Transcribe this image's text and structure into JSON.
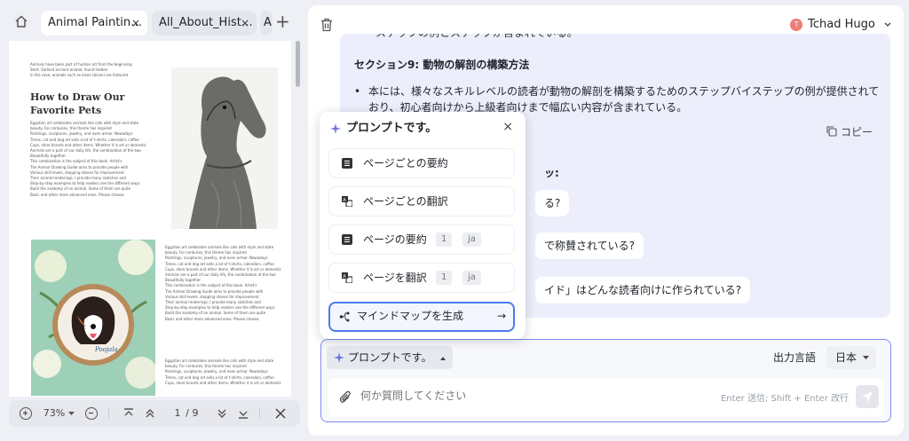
{
  "tabs": [
    {
      "label": "Animal Paintin…",
      "close": "×"
    },
    {
      "label": "All_About_Hist…",
      "close": "×"
    },
    {
      "label": "A"
    }
  ],
  "tab_add": "+",
  "document": {
    "intro": [
      "Animals have been part of human art from the beginning",
      "Start. Earliest ancient animal, found hidden",
      "In the cave, animals such as bison (bison) are featured."
    ],
    "title": "How to Draw Our Favorite Pets",
    "para1": [
      "Egyptian art celebrates animals like cats with style and state",
      "beauty. For centuries, this theme has inspired",
      "Paintings, sculptures, jewelry, and even armor. Nowadays",
      "Times, cat and dog art sells a lot of t-shirts, calendars, coffee",
      "Cups, store brands and other items. Whether it is art or domestic",
      "Animals are a part of our daily life, the combination of the two",
      "Beautifully together.",
      "This combination is the subject of this book. Artist's",
      "The Animal Drawing Guide aims to provide people with",
      "Various skill levels, stepping stones for improvement",
      "Their animal renderings. I provide many sketches and",
      "Step-by-step examples to help readers see the different ways",
      "Build the anatomy of an animal. Some of them are quite",
      "Basic and other more advanced ones. Please choose"
    ],
    "para2": [
      "Egyptian art celebrates animals like cats with style and state",
      "beauty. For centuries, this theme has inspired",
      "Paintings, sculptures, jewelry, and even armor. Nowadays",
      "Times, cat and dog art sells a lot of t-shirts, calendars, coffee",
      "Cups, store brands and other items. Whether it is art or domestic",
      "Animals are a part of our daily life, the combination of the two",
      "Beautifully together.",
      "This combination is the subject of this book. Artist's",
      "The Animal Drawing Guide aims to provide people with",
      "Various skill levels, stepping stones for improvement",
      "Their animal renderings. I provide many sketches and",
      "Step-by-step examples to help readers see the different ways",
      "Build the anatomy of an animal. Some of them are quite",
      "Basic and other more advanced ones. Please choose"
    ],
    "para3": [
      "Egyptian art celebrates animals like cats with style and state",
      "beauty. For centuries, this theme has inspired",
      "Paintings, sculptures, jewelry, and even armor. Nowadays",
      "Times, cat and dog art sells a lot of t-shirts, calendars, coffee",
      "Cups, store brands and other items. Whether it is art or domestic"
    ],
    "embroidery_text": "Poojala"
  },
  "toolbar": {
    "zoom": "73%",
    "page_current": "1",
    "page_sep": "/",
    "page_total": "9"
  },
  "header": {
    "avatar_letter": "T",
    "user_name": "Tchad Hugo"
  },
  "chat": {
    "top_cut": "ステップの例とステップが含まれている。",
    "section_heading": "セクション9: 動物の解剖の構築方法",
    "bullet": "本には、様々なスキルレベルの読者が動物の解剖を構築するためのステップバイステップの例が提供されており、初心者向けから上級者向けまで幅広い内容が含まれている。",
    "copy_label": "コピー",
    "partial_q": "ッ:",
    "bubbles": [
      "る?",
      "で称賛されている?",
      "イド」はどんな読者向けに作られている?"
    ]
  },
  "popup": {
    "title": "プロンプトです。",
    "close": "×",
    "items": [
      {
        "label": "ページごとの要約"
      },
      {
        "label": "ページごとの翻訳"
      },
      {
        "label": "ページの要約",
        "chip1": "1",
        "chip2": "ja"
      },
      {
        "label": "ページを翻訳",
        "chip1": "1",
        "chip2": "ja"
      },
      {
        "label": "マインドマップを生成",
        "arrow": "→"
      }
    ]
  },
  "input": {
    "prompt_button": "プロンプトです。",
    "output_language_label": "出力言語",
    "language": "日本",
    "placeholder": "何か質問してください",
    "hint": "Enter 送信; Shift + Enter 改行"
  }
}
